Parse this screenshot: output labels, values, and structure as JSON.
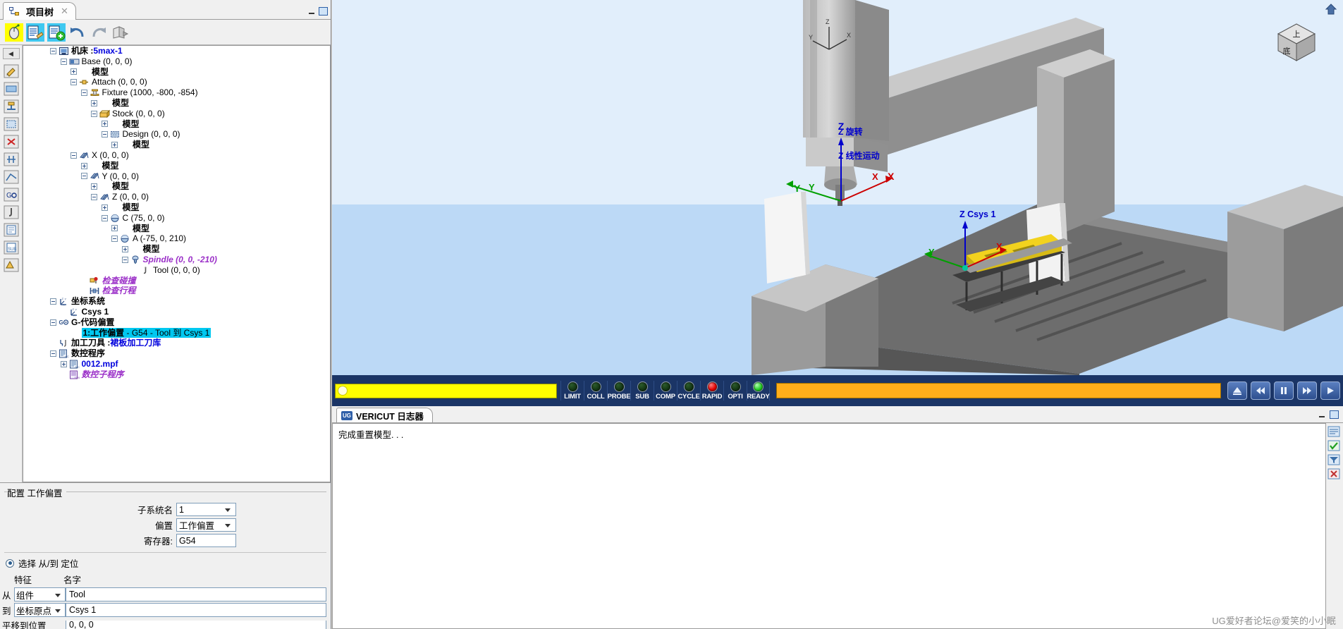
{
  "window": {
    "tab_title": "项目树",
    "tab_icon": "project-tree-icon",
    "close_glyph": "✕",
    "minimize_glyph": "▁",
    "restore_glyph": "❐"
  },
  "toolbar": {
    "buttons": [
      {
        "name": "mouse-config-icon",
        "label": "鼠标配置"
      },
      {
        "name": "edit-list-icon",
        "label": "编辑列表"
      },
      {
        "name": "add-component-icon",
        "label": "添加组件"
      },
      {
        "name": "undo-icon",
        "label": "撤销"
      },
      {
        "name": "redo-icon",
        "label": "重做"
      },
      {
        "name": "export-icon",
        "label": "导出"
      }
    ]
  },
  "icon_rail": {
    "collapse_glyph": "◀",
    "icons": [
      "pencil-icon",
      "stock-icon",
      "fixture-icon",
      "design-icon",
      "remove-icon",
      "machine-axis-icon",
      "tolerance-icon",
      "gcode-offset-icon",
      "tool-icon",
      "nc-program-icon",
      "nc-sub-icon",
      "tp-icon"
    ]
  },
  "tree": [
    {
      "depth": 0,
      "expander": "minus",
      "icon": "machine-icon",
      "prefix": "机床 :",
      "prefix_style": "bold",
      "value": "5max-1",
      "value_style": "blue"
    },
    {
      "depth": 1,
      "expander": "minus",
      "icon": "base-icon",
      "prefix": "",
      "value": "Base (0, 0, 0)",
      "value_style": "plain"
    },
    {
      "depth": 2,
      "expander": "plus",
      "icon": "model-icon",
      "prefix": "",
      "value": "模型",
      "value_style": "bold"
    },
    {
      "depth": 2,
      "expander": "minus",
      "icon": "attach-icon",
      "prefix": "",
      "value": "Attach (0, 0, 0)",
      "value_style": "plain"
    },
    {
      "depth": 3,
      "expander": "minus",
      "icon": "fixture-icon",
      "prefix": "",
      "value": "Fixture (1000, -800, -854)",
      "value_style": "plain"
    },
    {
      "depth": 4,
      "expander": "plus",
      "icon": "model-icon",
      "prefix": "",
      "value": "模型",
      "value_style": "bold"
    },
    {
      "depth": 4,
      "expander": "minus",
      "icon": "stock-icon",
      "prefix": "",
      "value": "Stock (0, 0, 0)",
      "value_style": "plain"
    },
    {
      "depth": 5,
      "expander": "plus",
      "icon": "model-icon",
      "prefix": "",
      "value": "模型",
      "value_style": "bold"
    },
    {
      "depth": 5,
      "expander": "minus",
      "icon": "design-icon",
      "prefix": "",
      "value": "Design (0, 0, 0)",
      "value_style": "plain"
    },
    {
      "depth": 6,
      "expander": "plus",
      "icon": "model-icon",
      "prefix": "",
      "value": "模型",
      "value_style": "bold"
    },
    {
      "depth": 2,
      "expander": "minus",
      "icon": "axis-icon",
      "prefix": "",
      "value": "X (0, 0, 0)",
      "value_style": "plain"
    },
    {
      "depth": 3,
      "expander": "plus",
      "icon": "model-icon",
      "prefix": "",
      "value": "模型",
      "value_style": "bold"
    },
    {
      "depth": 3,
      "expander": "minus",
      "icon": "axis-icon",
      "prefix": "",
      "value": "Y (0, 0, 0)",
      "value_style": "plain"
    },
    {
      "depth": 4,
      "expander": "plus",
      "icon": "model-icon",
      "prefix": "",
      "value": "模型",
      "value_style": "bold"
    },
    {
      "depth": 4,
      "expander": "minus",
      "icon": "axis-icon",
      "prefix": "",
      "value": "Z (0, 0, 0)",
      "value_style": "plain"
    },
    {
      "depth": 5,
      "expander": "plus",
      "icon": "model-icon",
      "prefix": "",
      "value": "模型",
      "value_style": "bold"
    },
    {
      "depth": 5,
      "expander": "minus",
      "icon": "rotary-icon",
      "prefix": "",
      "value": "C (75, 0, 0)",
      "value_style": "plain"
    },
    {
      "depth": 6,
      "expander": "plus",
      "icon": "model-icon",
      "prefix": "",
      "value": "模型",
      "value_style": "bold"
    },
    {
      "depth": 6,
      "expander": "minus",
      "icon": "rotary-icon",
      "prefix": "",
      "value": "A (-75, 0, 210)",
      "value_style": "plain"
    },
    {
      "depth": 7,
      "expander": "plus",
      "icon": "model-icon",
      "prefix": "",
      "value": "模型",
      "value_style": "bold"
    },
    {
      "depth": 7,
      "expander": "minus",
      "icon": "spindle-icon",
      "prefix": "",
      "value": "Spindle (0, 0, -210)",
      "value_style": "purple"
    },
    {
      "depth": 8,
      "expander": "none",
      "icon": "tool-icon",
      "prefix": "",
      "value": "Tool (0, 0, 0)",
      "value_style": "plain"
    },
    {
      "depth": 3,
      "expander": "none",
      "icon": "collision-icon",
      "prefix": "",
      "value": "检查碰撞",
      "value_style": "purple"
    },
    {
      "depth": 3,
      "expander": "none",
      "icon": "travel-icon",
      "prefix": "",
      "value": "检查行程",
      "value_style": "purple"
    },
    {
      "depth": 0,
      "expander": "minus",
      "icon": "csys-icon",
      "prefix": "",
      "value": "坐标系统",
      "value_style": "bold"
    },
    {
      "depth": 1,
      "expander": "none",
      "icon": "csys-icon",
      "prefix": "",
      "value": "Csys 1",
      "value_style": "bold"
    },
    {
      "depth": 0,
      "expander": "minus",
      "icon": "gcode-offset-icon",
      "prefix": "",
      "value": "G-代码偏置",
      "value_style": "bold"
    },
    {
      "depth": 1,
      "expander": "none",
      "icon": "none",
      "prefix": "",
      "value": "1:工作偏置 - G54 - Tool 到 Csys 1",
      "value_style": "selected",
      "selected_bold_part": "1:工作偏置"
    },
    {
      "depth": 0,
      "expander": "none",
      "icon": "tooling-icon",
      "prefix": "加工刀具 :",
      "prefix_style": "bold",
      "value": "裙板加工刀库",
      "value_style": "blue"
    },
    {
      "depth": 0,
      "expander": "minus",
      "icon": "nc-program-icon",
      "prefix": "",
      "value": "数控程序",
      "value_style": "bold"
    },
    {
      "depth": 1,
      "expander": "plus",
      "icon": "nc-program-icon",
      "prefix": "",
      "value": "0012.mpf",
      "value_style": "blue"
    },
    {
      "depth": 1,
      "expander": "none",
      "icon": "nc-sub-icon",
      "prefix": "",
      "value": "数控子程序",
      "value_style": "purple"
    }
  ],
  "config_panel": {
    "title": "配置 工作偏置",
    "fields": [
      {
        "label": "子系统名",
        "value": "1",
        "type": "select"
      },
      {
        "label": "偏置",
        "value": "工作偏置",
        "type": "select"
      },
      {
        "label": "寄存器:",
        "value": "G54",
        "type": "input"
      }
    ],
    "radio_label": "选择 从/到 定位",
    "radio_checked": true,
    "columns": {
      "feature": "特征",
      "name": "名字"
    },
    "rows": [
      {
        "prefix": "从",
        "feature": "组件",
        "name": "Tool"
      },
      {
        "prefix": "到",
        "feature": "坐标原点",
        "name": "Csys 1"
      }
    ],
    "offset_row": {
      "label": "平移到位置",
      "value": "0, 0, 0"
    }
  },
  "viewport": {
    "axis_labels": [
      {
        "text": "Z",
        "color": "#0000cc"
      },
      {
        "text": "X",
        "color": "#cc0000"
      },
      {
        "text": "Y",
        "color": "#009900"
      }
    ],
    "annotations": [
      {
        "text": "Z 旋转",
        "color": "#0000cc"
      },
      {
        "text": "Z 线性运动",
        "color": "#0000cc"
      },
      {
        "text": "Z Csys 1",
        "color": "#0000cc"
      }
    ],
    "view_cube": {
      "top": "上",
      "front": "底"
    },
    "home_icon": "home-icon"
  },
  "statusbar": {
    "progress_value": 100,
    "leds": [
      {
        "label": "LIMIT",
        "state": "off"
      },
      {
        "label": "COLL",
        "state": "off"
      },
      {
        "label": "PROBE",
        "state": "off"
      },
      {
        "label": "SUB",
        "state": "off"
      },
      {
        "label": "COMP",
        "state": "off"
      },
      {
        "label": "CYCLE",
        "state": "off"
      },
      {
        "label": "RAPID",
        "state": "red"
      },
      {
        "label": "OPTI",
        "state": "off"
      },
      {
        "label": "READY",
        "state": "green"
      }
    ],
    "orange_bar_value": 100,
    "controls": [
      {
        "name": "reset-button",
        "glyph": "⏏"
      },
      {
        "name": "step-back-button",
        "glyph": "⏪"
      },
      {
        "name": "pause-button",
        "glyph": "⏸"
      },
      {
        "name": "step-forward-button",
        "glyph": "⏩"
      },
      {
        "name": "play-button",
        "glyph": "⏵"
      }
    ],
    "colors": {
      "panel_bg": "#1b3566",
      "progress": "#ffff00",
      "orange": "#ffae1a",
      "led_red": "#e00000",
      "led_green": "#22cc22"
    }
  },
  "log": {
    "tab_title": "VERICUT 日志器",
    "tab_badge": "UG",
    "message": "完成重置模型. . .",
    "minimize_glyph": "▁",
    "restore_glyph": "❐",
    "rail_icons": [
      "log-list-icon",
      "log-check-icon",
      "log-filter-icon",
      "log-clear-icon"
    ]
  },
  "watermark": "UG爱好者论坛@爱笑的小小眠"
}
